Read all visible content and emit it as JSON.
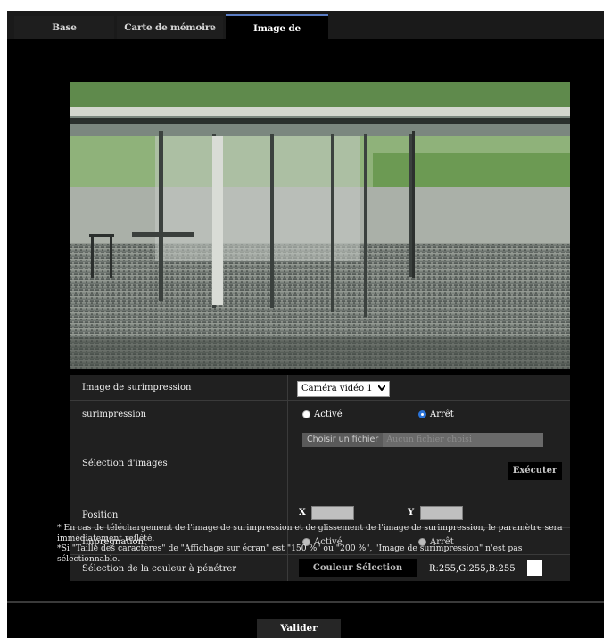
{
  "tabs": [
    {
      "label": "Base",
      "active": false
    },
    {
      "label": "Carte de mémoire SD",
      "active": false
    },
    {
      "label": "Image de surimpression",
      "active": true
    }
  ],
  "settings": {
    "overlay_image": {
      "label": "Image de surimpression",
      "value": "Caméra vidéo 1"
    },
    "overlay": {
      "label": "surimpression",
      "option_on": "Activé",
      "option_off": "Arrêt",
      "selected": "Arrêt"
    },
    "image_selection": {
      "label": "Sélection d'images",
      "file_button": "Choisir un fichier",
      "file_status": "Aucun fichier choisi",
      "execute": "Exécuter"
    },
    "position": {
      "label": "Position",
      "x_label": "X",
      "y_label": "Y",
      "x_value": "",
      "y_value": ""
    },
    "impregnation": {
      "label": "Imprégnation",
      "option_on": "Activé",
      "option_off": "Arrêt",
      "enabled": false
    },
    "transparent_color": {
      "label": "Sélection de la couleur à pénétrer",
      "button": "Couleur Sélection",
      "value": "R:255,G:255,B:255",
      "swatch": "#ffffff"
    }
  },
  "notes": [
    "* En cas de téléchargement de l'image de surimpression et de glissement de l'image de surimpression, le paramètre sera immédiatement reflété.",
    "*Si \"Taille des caractères\" de \"Affichage sur écran\" est \"150 %\" ou \"200 %\", \"Image de surimpression\" n'est pas sélectionnable."
  ],
  "footer": {
    "submit": "Valider"
  },
  "colors": {
    "accent": "#5b7dc4",
    "radio_selected": "#2a73d8"
  }
}
